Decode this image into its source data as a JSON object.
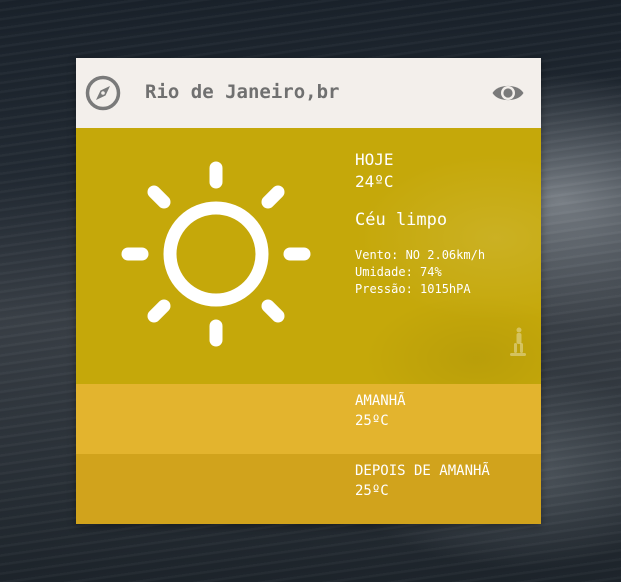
{
  "header": {
    "city": "Rio de Janeiro,br",
    "left_icon": "compass-icon",
    "right_icon": "eye-icon"
  },
  "today": {
    "label": "HOJE",
    "temperature": "24ºC",
    "description": "Céu limpo",
    "wind": "Vento: NO 2.06km/h",
    "humidity": "Umidade: 74%",
    "pressure": "Pressão: 1015hPA",
    "icon": "sun-icon"
  },
  "forecast": [
    {
      "label": "AMANHÃ",
      "temperature": "25ºC"
    },
    {
      "label": "DEPOIS DE AMANHÃ",
      "temperature": "25ºC"
    }
  ],
  "colors": {
    "header_bg": "#f3efeb",
    "header_text": "#707070",
    "today_bg": "#c5a80a",
    "tomorrow_bg": "#e3b42e",
    "after_bg": "#d1a31c",
    "text": "#ffffff"
  }
}
